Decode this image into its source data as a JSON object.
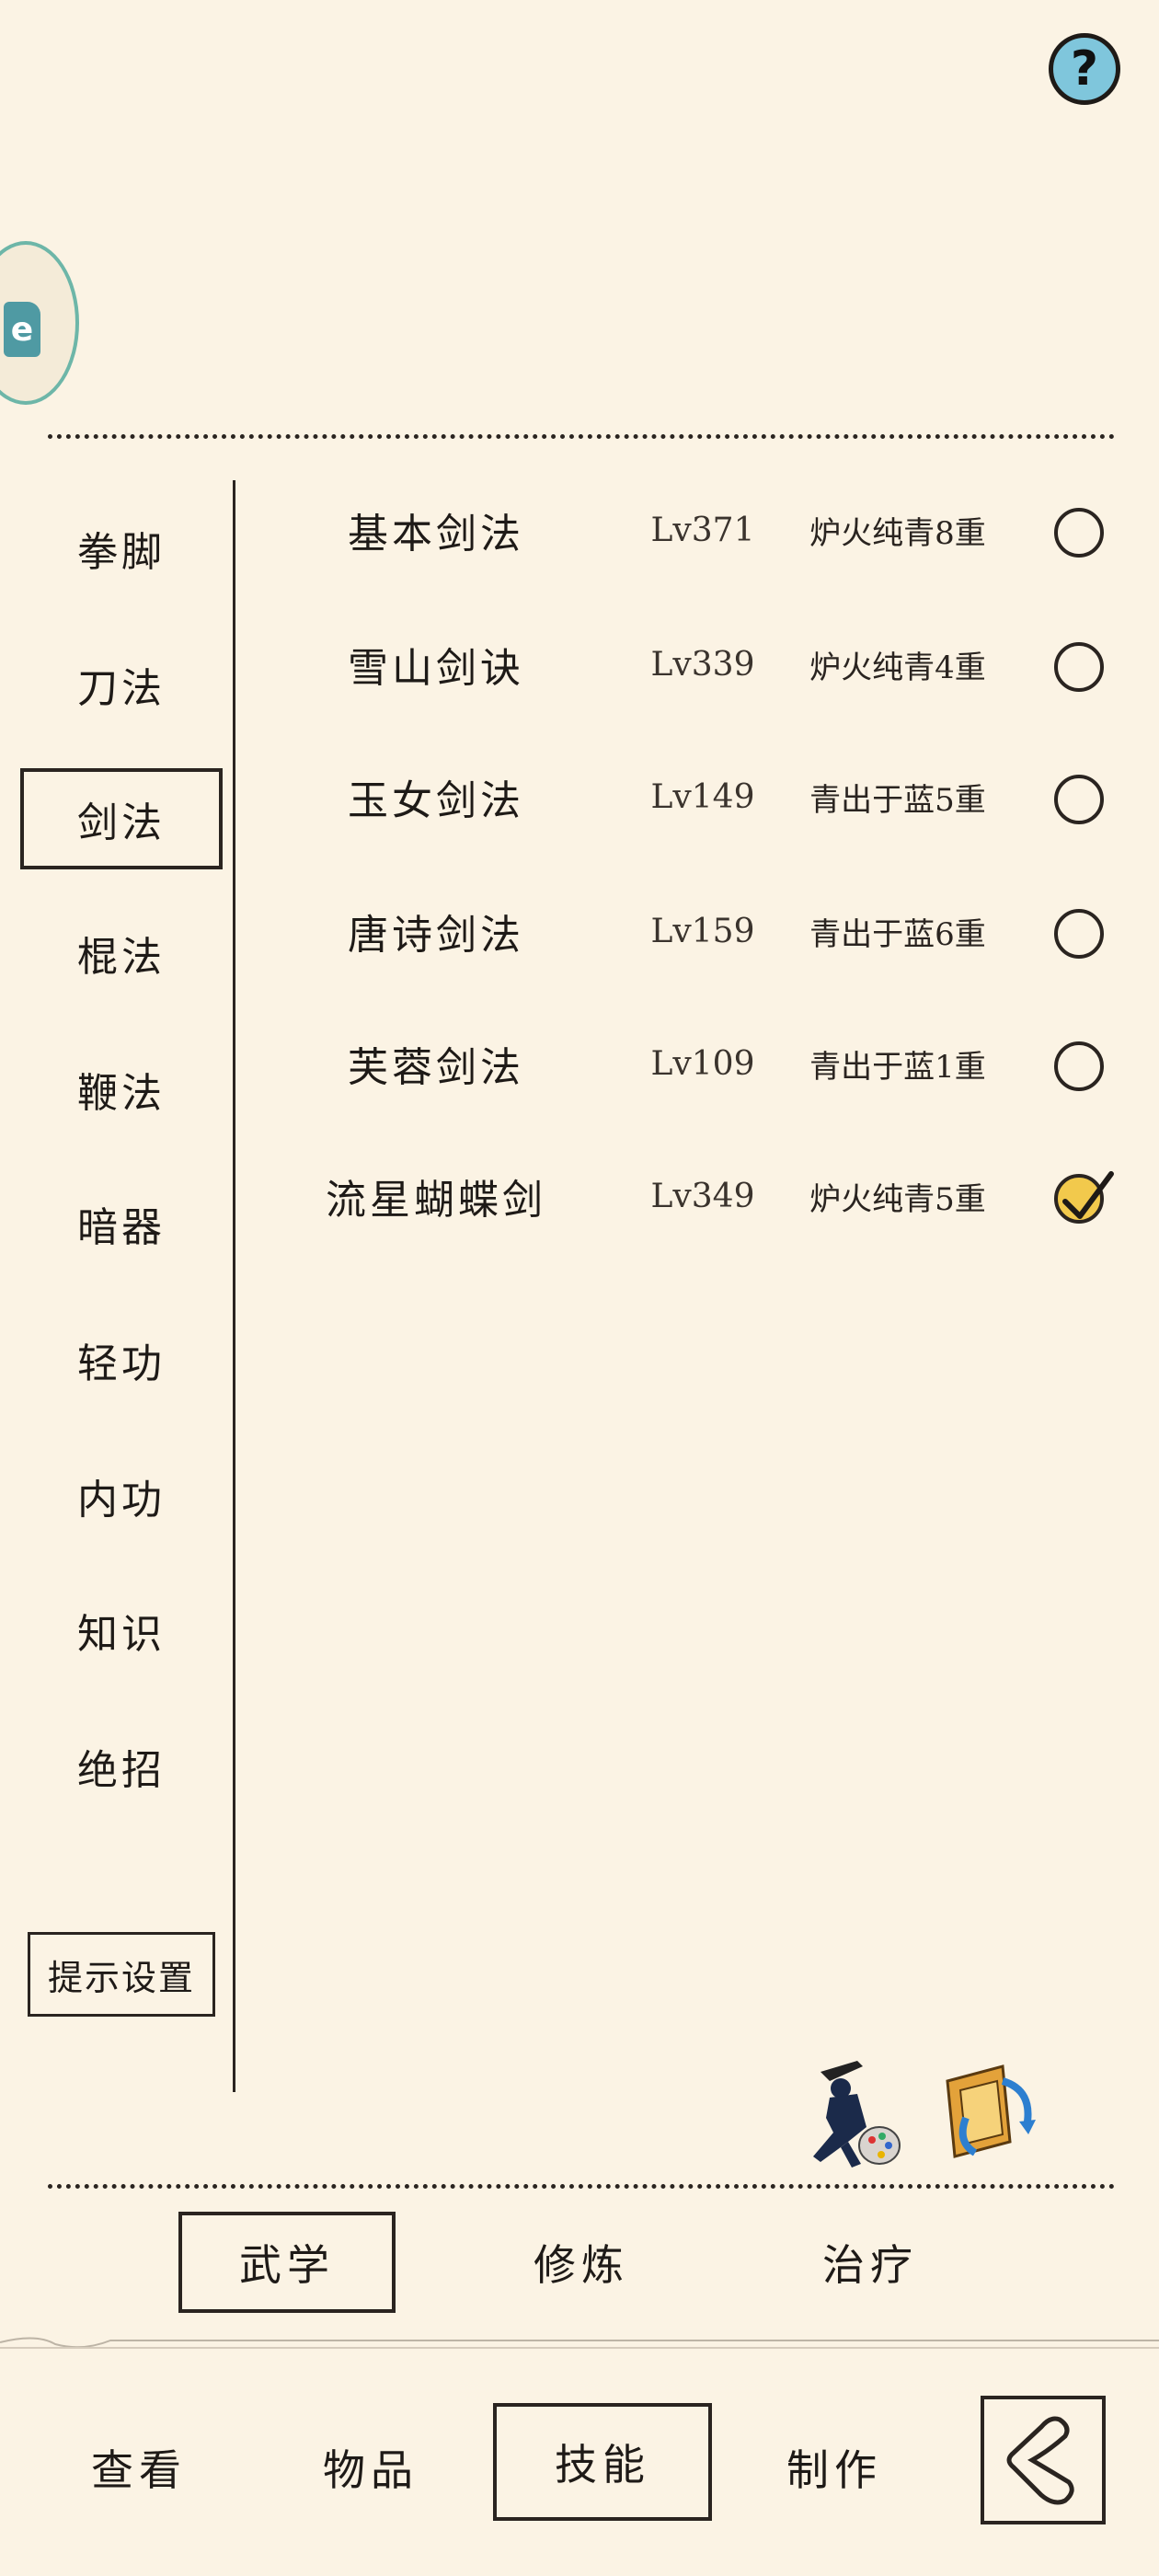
{
  "header": {
    "help_icon": "help-icon",
    "help_label": "?",
    "avatar_icon": "game-app-icon"
  },
  "categories": [
    {
      "label": "拳脚",
      "selected": false
    },
    {
      "label": "刀法",
      "selected": false
    },
    {
      "label": "剑法",
      "selected": true
    },
    {
      "label": "棍法",
      "selected": false
    },
    {
      "label": "鞭法",
      "selected": false
    },
    {
      "label": "暗器",
      "selected": false
    },
    {
      "label": "轻功",
      "selected": false
    },
    {
      "label": "内功",
      "selected": false
    },
    {
      "label": "知识",
      "selected": false
    },
    {
      "label": "绝招",
      "selected": false
    }
  ],
  "tip_settings_label": "提示设置",
  "skills": [
    {
      "name": "基本剑法",
      "level": "Lv371",
      "rank": "炉火纯青8重",
      "checked": false
    },
    {
      "name": "雪山剑诀",
      "level": "Lv339",
      "rank": "炉火纯青4重",
      "checked": false
    },
    {
      "name": "玉女剑法",
      "level": "Lv149",
      "rank": "青出于蓝5重",
      "checked": false
    },
    {
      "name": "唐诗剑法",
      "level": "Lv159",
      "rank": "青出于蓝6重",
      "checked": false
    },
    {
      "name": "芙蓉剑法",
      "level": "Lv109",
      "rank": "青出于蓝1重",
      "checked": false
    },
    {
      "name": "流星蝴蝶剑",
      "level": "Lv349",
      "rank": "炉火纯青5重",
      "checked": true
    }
  ],
  "tools": [
    "martial-art-palette-icon",
    "scroll-book-icon"
  ],
  "subtabs": [
    {
      "label": "武学",
      "selected": true
    },
    {
      "label": "修炼",
      "selected": false
    },
    {
      "label": "治疗",
      "selected": false
    }
  ],
  "bottom_nav": [
    {
      "label": "查看",
      "selected": false
    },
    {
      "label": "物品",
      "selected": false
    },
    {
      "label": "技能",
      "selected": true
    },
    {
      "label": "制作",
      "selected": false
    }
  ],
  "back_icon": "back-arrow-icon",
  "colors": {
    "background": "#fbf3e4",
    "ink": "#2a2420",
    "check_fill": "#f2c94c",
    "help_fill": "#7fc6dc"
  }
}
